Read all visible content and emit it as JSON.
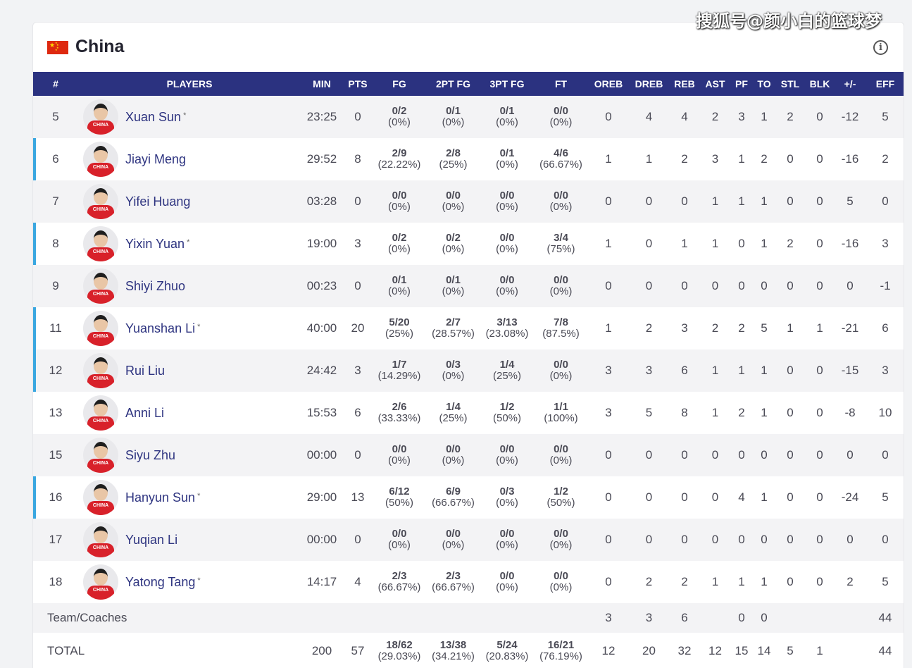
{
  "watermark": "搜狐号@颜小白的篮球梦",
  "team": {
    "name": "China"
  },
  "columns": [
    "#",
    "PLAYERS",
    "MIN",
    "PTS",
    "FG",
    "2PT FG",
    "3PT FG",
    "FT",
    "OREB",
    "DREB",
    "REB",
    "AST",
    "PF",
    "TO",
    "STL",
    "BLK",
    "+/-",
    "EFF"
  ],
  "players": [
    {
      "num": "5",
      "name": "Xuan Sun",
      "starter_mark": "*",
      "starter": false,
      "min": "23:25",
      "pts": "0",
      "fg": "0/2",
      "fg_pct": "(0%)",
      "fg2": "0/1",
      "fg2_pct": "(0%)",
      "fg3": "0/1",
      "fg3_pct": "(0%)",
      "ft": "0/0",
      "ft_pct": "(0%)",
      "oreb": "0",
      "dreb": "4",
      "reb": "4",
      "ast": "2",
      "pf": "3",
      "to": "1",
      "stl": "2",
      "blk": "0",
      "pm": "-12",
      "eff": "5"
    },
    {
      "num": "6",
      "name": "Jiayi Meng",
      "starter_mark": "",
      "starter": true,
      "min": "29:52",
      "pts": "8",
      "fg": "2/9",
      "fg_pct": "(22.22%)",
      "fg2": "2/8",
      "fg2_pct": "(25%)",
      "fg3": "0/1",
      "fg3_pct": "(0%)",
      "ft": "4/6",
      "ft_pct": "(66.67%)",
      "oreb": "1",
      "dreb": "1",
      "reb": "2",
      "ast": "3",
      "pf": "1",
      "to": "2",
      "stl": "0",
      "blk": "0",
      "pm": "-16",
      "eff": "2"
    },
    {
      "num": "7",
      "name": "Yifei Huang",
      "starter_mark": "",
      "starter": false,
      "min": "03:28",
      "pts": "0",
      "fg": "0/0",
      "fg_pct": "(0%)",
      "fg2": "0/0",
      "fg2_pct": "(0%)",
      "fg3": "0/0",
      "fg3_pct": "(0%)",
      "ft": "0/0",
      "ft_pct": "(0%)",
      "oreb": "0",
      "dreb": "0",
      "reb": "0",
      "ast": "1",
      "pf": "1",
      "to": "1",
      "stl": "0",
      "blk": "0",
      "pm": "5",
      "eff": "0"
    },
    {
      "num": "8",
      "name": "Yixin Yuan",
      "starter_mark": "*",
      "starter": true,
      "min": "19:00",
      "pts": "3",
      "fg": "0/2",
      "fg_pct": "(0%)",
      "fg2": "0/2",
      "fg2_pct": "(0%)",
      "fg3": "0/0",
      "fg3_pct": "(0%)",
      "ft": "3/4",
      "ft_pct": "(75%)",
      "oreb": "1",
      "dreb": "0",
      "reb": "1",
      "ast": "1",
      "pf": "0",
      "to": "1",
      "stl": "2",
      "blk": "0",
      "pm": "-16",
      "eff": "3"
    },
    {
      "num": "9",
      "name": "Shiyi Zhuo",
      "starter_mark": "",
      "starter": false,
      "min": "00:23",
      "pts": "0",
      "fg": "0/1",
      "fg_pct": "(0%)",
      "fg2": "0/1",
      "fg2_pct": "(0%)",
      "fg3": "0/0",
      "fg3_pct": "(0%)",
      "ft": "0/0",
      "ft_pct": "(0%)",
      "oreb": "0",
      "dreb": "0",
      "reb": "0",
      "ast": "0",
      "pf": "0",
      "to": "0",
      "stl": "0",
      "blk": "0",
      "pm": "0",
      "eff": "-1"
    },
    {
      "num": "11",
      "name": "Yuanshan Li",
      "starter_mark": "*",
      "starter": true,
      "min": "40:00",
      "pts": "20",
      "fg": "5/20",
      "fg_pct": "(25%)",
      "fg2": "2/7",
      "fg2_pct": "(28.57%)",
      "fg3": "3/13",
      "fg3_pct": "(23.08%)",
      "ft": "7/8",
      "ft_pct": "(87.5%)",
      "oreb": "1",
      "dreb": "2",
      "reb": "3",
      "ast": "2",
      "pf": "2",
      "to": "5",
      "stl": "1",
      "blk": "1",
      "pm": "-21",
      "eff": "6"
    },
    {
      "num": "12",
      "name": "Rui Liu",
      "starter_mark": "",
      "starter": true,
      "min": "24:42",
      "pts": "3",
      "fg": "1/7",
      "fg_pct": "(14.29%)",
      "fg2": "0/3",
      "fg2_pct": "(0%)",
      "fg3": "1/4",
      "fg3_pct": "(25%)",
      "ft": "0/0",
      "ft_pct": "(0%)",
      "oreb": "3",
      "dreb": "3",
      "reb": "6",
      "ast": "1",
      "pf": "1",
      "to": "1",
      "stl": "0",
      "blk": "0",
      "pm": "-15",
      "eff": "3"
    },
    {
      "num": "13",
      "name": "Anni Li",
      "starter_mark": "",
      "starter": false,
      "min": "15:53",
      "pts": "6",
      "fg": "2/6",
      "fg_pct": "(33.33%)",
      "fg2": "1/4",
      "fg2_pct": "(25%)",
      "fg3": "1/2",
      "fg3_pct": "(50%)",
      "ft": "1/1",
      "ft_pct": "(100%)",
      "oreb": "3",
      "dreb": "5",
      "reb": "8",
      "ast": "1",
      "pf": "2",
      "to": "1",
      "stl": "0",
      "blk": "0",
      "pm": "-8",
      "eff": "10"
    },
    {
      "num": "15",
      "name": "Siyu Zhu",
      "starter_mark": "",
      "starter": false,
      "min": "00:00",
      "pts": "0",
      "fg": "0/0",
      "fg_pct": "(0%)",
      "fg2": "0/0",
      "fg2_pct": "(0%)",
      "fg3": "0/0",
      "fg3_pct": "(0%)",
      "ft": "0/0",
      "ft_pct": "(0%)",
      "oreb": "0",
      "dreb": "0",
      "reb": "0",
      "ast": "0",
      "pf": "0",
      "to": "0",
      "stl": "0",
      "blk": "0",
      "pm": "0",
      "eff": "0"
    },
    {
      "num": "16",
      "name": "Hanyun Sun",
      "starter_mark": "*",
      "starter": true,
      "min": "29:00",
      "pts": "13",
      "fg": "6/12",
      "fg_pct": "(50%)",
      "fg2": "6/9",
      "fg2_pct": "(66.67%)",
      "fg3": "0/3",
      "fg3_pct": "(0%)",
      "ft": "1/2",
      "ft_pct": "(50%)",
      "oreb": "0",
      "dreb": "0",
      "reb": "0",
      "ast": "0",
      "pf": "4",
      "to": "1",
      "stl": "0",
      "blk": "0",
      "pm": "-24",
      "eff": "5"
    },
    {
      "num": "17",
      "name": "Yuqian Li",
      "starter_mark": "",
      "starter": false,
      "min": "00:00",
      "pts": "0",
      "fg": "0/0",
      "fg_pct": "(0%)",
      "fg2": "0/0",
      "fg2_pct": "(0%)",
      "fg3": "0/0",
      "fg3_pct": "(0%)",
      "ft": "0/0",
      "ft_pct": "(0%)",
      "oreb": "0",
      "dreb": "0",
      "reb": "0",
      "ast": "0",
      "pf": "0",
      "to": "0",
      "stl": "0",
      "blk": "0",
      "pm": "0",
      "eff": "0"
    },
    {
      "num": "18",
      "name": "Yatong Tang",
      "starter_mark": "*",
      "starter": false,
      "min": "14:17",
      "pts": "4",
      "fg": "2/3",
      "fg_pct": "(66.67%)",
      "fg2": "2/3",
      "fg2_pct": "(66.67%)",
      "fg3": "0/0",
      "fg3_pct": "(0%)",
      "ft": "0/0",
      "ft_pct": "(0%)",
      "oreb": "0",
      "dreb": "2",
      "reb": "2",
      "ast": "1",
      "pf": "1",
      "to": "1",
      "stl": "0",
      "blk": "0",
      "pm": "2",
      "eff": "5"
    }
  ],
  "team_coaches": {
    "label": "Team/Coaches",
    "oreb": "3",
    "dreb": "3",
    "reb": "6",
    "ast": "",
    "pf": "0",
    "to": "0",
    "stl": "",
    "blk": "",
    "pm": "",
    "eff": "44"
  },
  "total": {
    "label": "TOTAL",
    "min": "200",
    "pts": "57",
    "fg": "18/62",
    "fg_pct": "(29.03%)",
    "fg2": "13/38",
    "fg2_pct": "(34.21%)",
    "fg3": "5/24",
    "fg3_pct": "(20.83%)",
    "ft": "16/21",
    "ft_pct": "(76.19%)",
    "oreb": "12",
    "dreb": "20",
    "reb": "32",
    "ast": "12",
    "pf": "15",
    "to": "14",
    "stl": "5",
    "blk": "1",
    "pm": "",
    "eff": "44"
  },
  "avatar_text": "CHINA",
  "colors": {
    "header_bg": "#2b3280",
    "starter_accent": "#3aa7e0",
    "name_link": "#2e3480",
    "flag": "#de2910"
  }
}
